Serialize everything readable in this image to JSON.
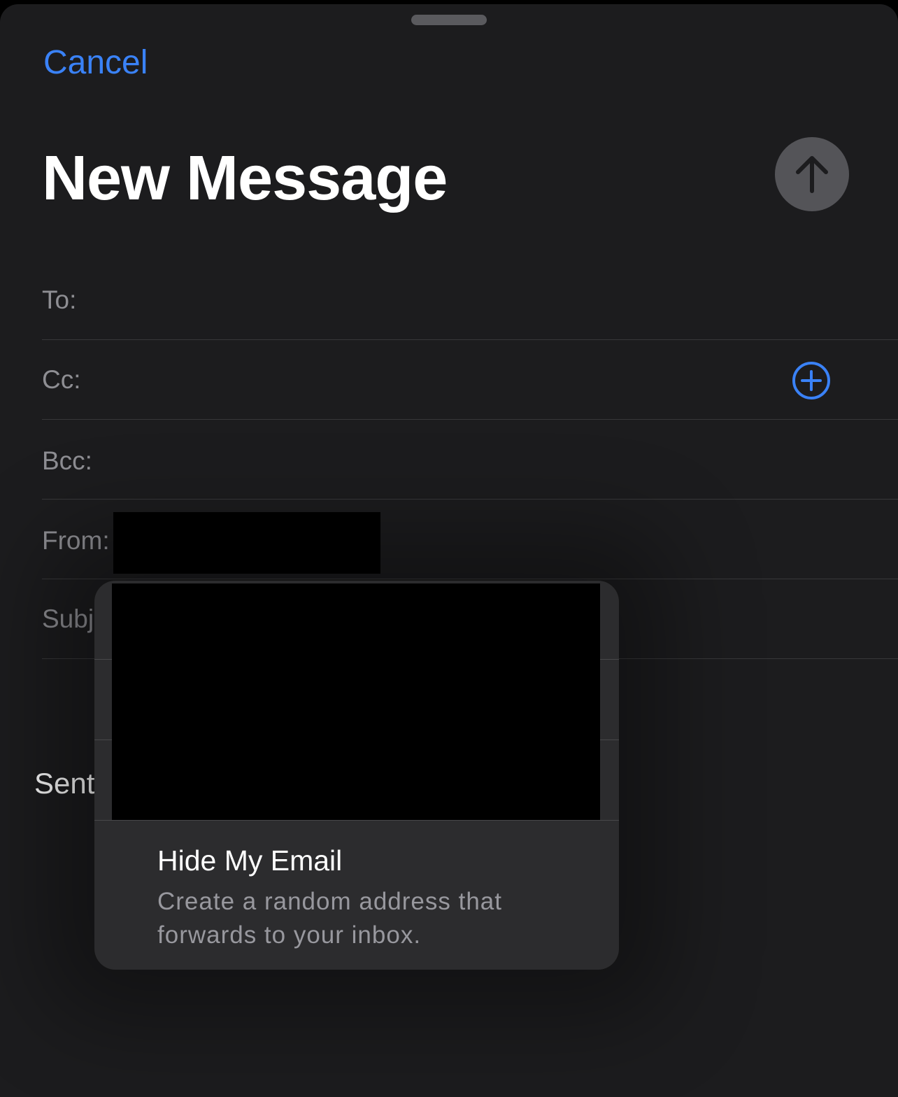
{
  "header": {
    "cancel_label": "Cancel",
    "title": "New Message"
  },
  "fields": {
    "to_label": "To:",
    "cc_label": "Cc:",
    "bcc_label": "Bcc:",
    "from_label": "From:",
    "subject_label": "Subj"
  },
  "body": {
    "sent_text": "Sent"
  },
  "from_popup": {
    "hide_my_email_title": "Hide My Email",
    "hide_my_email_description": "Create a random address that forwards to your inbox."
  },
  "colors": {
    "accent": "#3a82f7",
    "background": "#1c1c1e",
    "popup_background": "#2c2c2e"
  },
  "icons": {
    "send": "arrow-up-icon",
    "add_cc": "plus-circle-icon"
  }
}
